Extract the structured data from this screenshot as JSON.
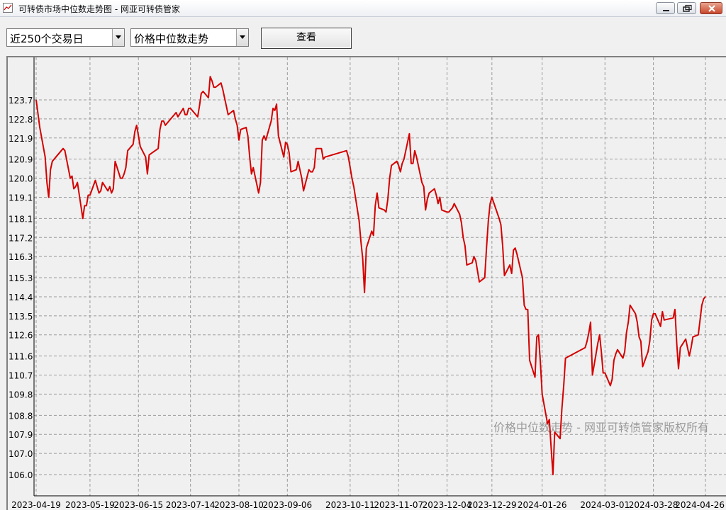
{
  "window": {
    "title": "可转债市场中位数走势图 - 网亚可转债管家"
  },
  "toolbar": {
    "period_select": "近250个交易日",
    "metric_select": "价格中位数走势",
    "view_button": "查看"
  },
  "chart_data": {
    "type": "line",
    "title": "",
    "xlabel": "",
    "ylabel": "",
    "watermark": "价格中位数走势 - 网亚可转债管家版权所有",
    "grid": true,
    "y_ticks": [
      "123.7",
      "122.8",
      "121.9",
      "120.9",
      "120.0",
      "119.1",
      "118.1",
      "117.2",
      "116.3",
      "115.3",
      "114.4",
      "113.5",
      "112.6",
      "111.6",
      "110.7",
      "109.8",
      "108.8",
      "107.9",
      "107.0",
      "106.0"
    ],
    "x_ticks": [
      "2023-04-19",
      "2023-05-19",
      "2023-06-15",
      "2023-07-14",
      "2023-08-10",
      "2023-09-06",
      "2023-10-11",
      "2023-11-07",
      "2023-12-04",
      "2023-12-29",
      "2024-01-26",
      "2024-03-01",
      "2024-03-28",
      "2024-04-26"
    ],
    "ylim": [
      105.3,
      125.5
    ],
    "line_color": "#d40000",
    "series": [
      {
        "name": "",
        "points": [
          [
            "2023-04-19",
            123.7
          ],
          [
            "2023-04-21",
            122.4
          ],
          [
            "2023-04-24",
            121.0
          ],
          [
            "2023-04-25",
            119.8
          ],
          [
            "2023-04-26",
            119.1
          ],
          [
            "2023-04-27",
            120.4
          ],
          [
            "2023-04-28",
            120.8
          ],
          [
            "2023-05-04",
            121.4
          ],
          [
            "2023-05-05",
            121.3
          ],
          [
            "2023-05-08",
            120.0
          ],
          [
            "2023-05-09",
            120.1
          ],
          [
            "2023-05-10",
            119.5
          ],
          [
            "2023-05-11",
            119.6
          ],
          [
            "2023-05-12",
            119.8
          ],
          [
            "2023-05-15",
            118.1
          ],
          [
            "2023-05-16",
            118.7
          ],
          [
            "2023-05-17",
            118.7
          ],
          [
            "2023-05-18",
            119.2
          ],
          [
            "2023-05-19",
            119.2
          ],
          [
            "2023-05-22",
            119.9
          ],
          [
            "2023-05-23",
            119.6
          ],
          [
            "2023-05-24",
            119.3
          ],
          [
            "2023-05-25",
            119.4
          ],
          [
            "2023-05-26",
            119.8
          ],
          [
            "2023-05-29",
            119.4
          ],
          [
            "2023-05-30",
            119.6
          ],
          [
            "2023-05-31",
            119.3
          ],
          [
            "2023-06-01",
            119.5
          ],
          [
            "2023-06-02",
            120.8
          ],
          [
            "2023-06-05",
            120.0
          ],
          [
            "2023-06-06",
            120.0
          ],
          [
            "2023-06-07",
            120.2
          ],
          [
            "2023-06-08",
            120.5
          ],
          [
            "2023-06-09",
            121.3
          ],
          [
            "2023-06-12",
            121.6
          ],
          [
            "2023-06-13",
            122.2
          ],
          [
            "2023-06-14",
            122.5
          ],
          [
            "2023-06-15",
            122.0
          ],
          [
            "2023-06-16",
            121.5
          ],
          [
            "2023-06-19",
            121.0
          ],
          [
            "2023-06-20",
            120.2
          ],
          [
            "2023-06-21",
            121.1
          ],
          [
            "2023-06-26",
            121.4
          ],
          [
            "2023-06-27",
            122.3
          ],
          [
            "2023-06-28",
            122.7
          ],
          [
            "2023-06-29",
            122.7
          ],
          [
            "2023-06-30",
            122.5
          ],
          [
            "2023-07-03",
            122.8
          ],
          [
            "2023-07-04",
            122.9
          ],
          [
            "2023-07-05",
            123.0
          ],
          [
            "2023-07-06",
            123.1
          ],
          [
            "2023-07-07",
            122.9
          ],
          [
            "2023-07-10",
            123.3
          ],
          [
            "2023-07-11",
            123.0
          ],
          [
            "2023-07-12",
            123.0
          ],
          [
            "2023-07-13",
            123.3
          ],
          [
            "2023-07-14",
            123.3
          ],
          [
            "2023-07-17",
            123.0
          ],
          [
            "2023-07-18",
            122.9
          ],
          [
            "2023-07-19",
            123.4
          ],
          [
            "2023-07-20",
            124.0
          ],
          [
            "2023-07-21",
            124.1
          ],
          [
            "2023-07-24",
            123.8
          ],
          [
            "2023-07-25",
            124.8
          ],
          [
            "2023-07-26",
            124.6
          ],
          [
            "2023-07-27",
            124.3
          ],
          [
            "2023-07-28",
            124.3
          ],
          [
            "2023-07-31",
            124.5
          ],
          [
            "2023-08-01",
            124.2
          ],
          [
            "2023-08-02",
            123.8
          ],
          [
            "2023-08-03",
            123.4
          ],
          [
            "2023-08-04",
            123.0
          ],
          [
            "2023-08-07",
            123.2
          ],
          [
            "2023-08-08",
            122.8
          ],
          [
            "2023-08-09",
            122.5
          ],
          [
            "2023-08-10",
            121.8
          ],
          [
            "2023-08-11",
            122.3
          ],
          [
            "2023-08-14",
            122.4
          ],
          [
            "2023-08-15",
            122.0
          ],
          [
            "2023-08-16",
            121.0
          ],
          [
            "2023-08-17",
            120.2
          ],
          [
            "2023-08-18",
            120.5
          ],
          [
            "2023-08-21",
            119.3
          ],
          [
            "2023-08-22",
            119.8
          ],
          [
            "2023-08-23",
            121.8
          ],
          [
            "2023-08-24",
            122.0
          ],
          [
            "2023-08-25",
            121.8
          ],
          [
            "2023-08-28",
            122.7
          ],
          [
            "2023-08-29",
            123.3
          ],
          [
            "2023-08-30",
            123.2
          ],
          [
            "2023-08-31",
            123.5
          ],
          [
            "2023-09-01",
            122.0
          ],
          [
            "2023-09-04",
            121.0
          ],
          [
            "2023-09-05",
            121.7
          ],
          [
            "2023-09-06",
            121.6
          ],
          [
            "2023-09-07",
            121.2
          ],
          [
            "2023-09-08",
            120.3
          ],
          [
            "2023-09-11",
            120.4
          ],
          [
            "2023-09-12",
            120.8
          ],
          [
            "2023-09-13",
            120.4
          ],
          [
            "2023-09-14",
            120.0
          ],
          [
            "2023-09-15",
            119.4
          ],
          [
            "2023-09-18",
            120.4
          ],
          [
            "2023-09-19",
            120.3
          ],
          [
            "2023-09-20",
            120.3
          ],
          [
            "2023-09-21",
            120.5
          ],
          [
            "2023-09-22",
            121.4
          ],
          [
            "2023-09-25",
            121.4
          ],
          [
            "2023-09-26",
            120.9
          ],
          [
            "2023-09-27",
            121.0
          ],
          [
            "2023-10-09",
            121.3
          ],
          [
            "2023-10-10",
            121.0
          ],
          [
            "2023-10-11",
            120.5
          ],
          [
            "2023-10-12",
            120.0
          ],
          [
            "2023-10-13",
            119.6
          ],
          [
            "2023-10-16",
            118.0
          ],
          [
            "2023-10-17",
            117.0
          ],
          [
            "2023-10-18",
            116.2
          ],
          [
            "2023-10-19",
            114.6
          ],
          [
            "2023-10-20",
            116.7
          ],
          [
            "2023-10-23",
            117.5
          ],
          [
            "2023-10-24",
            117.3
          ],
          [
            "2023-10-25",
            118.7
          ],
          [
            "2023-10-26",
            119.3
          ],
          [
            "2023-10-27",
            118.6
          ],
          [
            "2023-10-30",
            118.5
          ],
          [
            "2023-10-31",
            118.4
          ],
          [
            "2023-11-01",
            119.0
          ],
          [
            "2023-11-02",
            120.0
          ],
          [
            "2023-11-03",
            120.6
          ],
          [
            "2023-11-06",
            120.8
          ],
          [
            "2023-11-07",
            120.6
          ],
          [
            "2023-11-08",
            120.3
          ],
          [
            "2023-11-09",
            120.7
          ],
          [
            "2023-11-10",
            120.9
          ],
          [
            "2023-11-13",
            122.1
          ],
          [
            "2023-11-14",
            120.7
          ],
          [
            "2023-11-15",
            120.7
          ],
          [
            "2023-11-16",
            121.3
          ],
          [
            "2023-11-17",
            121.0
          ],
          [
            "2023-11-20",
            119.8
          ],
          [
            "2023-11-21",
            119.6
          ],
          [
            "2023-11-22",
            118.5
          ],
          [
            "2023-11-23",
            119.0
          ],
          [
            "2023-11-24",
            119.3
          ],
          [
            "2023-11-27",
            119.5
          ],
          [
            "2023-11-28",
            119.2
          ],
          [
            "2023-11-29",
            118.8
          ],
          [
            "2023-11-30",
            119.1
          ],
          [
            "2023-12-01",
            118.5
          ],
          [
            "2023-12-04",
            118.4
          ],
          [
            "2023-12-05",
            118.4
          ],
          [
            "2023-12-06",
            118.5
          ],
          [
            "2023-12-07",
            118.6
          ],
          [
            "2023-12-08",
            118.8
          ],
          [
            "2023-12-11",
            118.3
          ],
          [
            "2023-12-12",
            117.9
          ],
          [
            "2023-12-13",
            117.2
          ],
          [
            "2023-12-14",
            116.8
          ],
          [
            "2023-12-15",
            115.9
          ],
          [
            "2023-12-18",
            116.0
          ],
          [
            "2023-12-19",
            116.3
          ],
          [
            "2023-12-20",
            116.1
          ],
          [
            "2023-12-21",
            115.6
          ],
          [
            "2023-12-22",
            115.1
          ],
          [
            "2023-12-25",
            115.3
          ],
          [
            "2023-12-26",
            116.7
          ],
          [
            "2023-12-27",
            118.0
          ],
          [
            "2023-12-28",
            118.8
          ],
          [
            "2023-12-29",
            119.1
          ],
          [
            "2024-01-02",
            118.1
          ],
          [
            "2024-01-03",
            117.8
          ],
          [
            "2024-01-04",
            116.8
          ],
          [
            "2024-01-05",
            115.4
          ],
          [
            "2024-01-08",
            115.9
          ],
          [
            "2024-01-09",
            115.5
          ],
          [
            "2024-01-10",
            116.6
          ],
          [
            "2024-01-11",
            116.7
          ],
          [
            "2024-01-12",
            116.4
          ],
          [
            "2024-01-15",
            115.3
          ],
          [
            "2024-01-16",
            114.0
          ],
          [
            "2024-01-17",
            113.8
          ],
          [
            "2024-01-18",
            113.8
          ],
          [
            "2024-01-19",
            111.4
          ],
          [
            "2024-01-22",
            110.6
          ],
          [
            "2024-01-23",
            112.5
          ],
          [
            "2024-01-24",
            112.6
          ],
          [
            "2024-01-25",
            111.3
          ],
          [
            "2024-01-26",
            109.8
          ],
          [
            "2024-01-29",
            108.4
          ],
          [
            "2024-01-30",
            108.6
          ],
          [
            "2024-01-31",
            107.3
          ],
          [
            "2024-02-01",
            106.0
          ],
          [
            "2024-02-02",
            108.0
          ],
          [
            "2024-02-05",
            107.7
          ],
          [
            "2024-02-06",
            109.1
          ],
          [
            "2024-02-07",
            110.2
          ],
          [
            "2024-02-08",
            111.5
          ],
          [
            "2024-02-19",
            112.0
          ],
          [
            "2024-02-20",
            112.3
          ],
          [
            "2024-02-21",
            112.7
          ],
          [
            "2024-02-22",
            113.2
          ],
          [
            "2024-02-23",
            110.7
          ],
          [
            "2024-02-26",
            112.2
          ],
          [
            "2024-02-27",
            112.6
          ],
          [
            "2024-02-28",
            111.8
          ],
          [
            "2024-02-29",
            110.8
          ],
          [
            "2024-03-01",
            110.8
          ],
          [
            "2024-03-04",
            110.2
          ],
          [
            "2024-03-05",
            110.5
          ],
          [
            "2024-03-06",
            111.4
          ],
          [
            "2024-03-07",
            111.7
          ],
          [
            "2024-03-08",
            111.9
          ],
          [
            "2024-03-11",
            111.5
          ],
          [
            "2024-03-12",
            111.8
          ],
          [
            "2024-03-13",
            112.7
          ],
          [
            "2024-03-14",
            113.2
          ],
          [
            "2024-03-15",
            114.0
          ],
          [
            "2024-03-18",
            113.6
          ],
          [
            "2024-03-19",
            113.2
          ],
          [
            "2024-03-20",
            112.5
          ],
          [
            "2024-03-21",
            112.3
          ],
          [
            "2024-03-22",
            111.1
          ],
          [
            "2024-03-25",
            111.8
          ],
          [
            "2024-03-26",
            112.3
          ],
          [
            "2024-03-27",
            113.3
          ],
          [
            "2024-03-28",
            113.6
          ],
          [
            "2024-03-29",
            113.6
          ],
          [
            "2024-04-01",
            113.0
          ],
          [
            "2024-04-02",
            113.7
          ],
          [
            "2024-04-03",
            113.3
          ],
          [
            "2024-04-08",
            113.4
          ],
          [
            "2024-04-09",
            113.8
          ],
          [
            "2024-04-10",
            112.2
          ],
          [
            "2024-04-11",
            111.0
          ],
          [
            "2024-04-12",
            112.0
          ],
          [
            "2024-04-15",
            112.4
          ],
          [
            "2024-04-16",
            112.0
          ],
          [
            "2024-04-17",
            111.6
          ],
          [
            "2024-04-18",
            112.0
          ],
          [
            "2024-04-19",
            112.5
          ],
          [
            "2024-04-22",
            112.6
          ],
          [
            "2024-04-23",
            113.3
          ],
          [
            "2024-04-24",
            114.0
          ],
          [
            "2024-04-25",
            114.3
          ],
          [
            "2024-04-26",
            114.4
          ]
        ]
      }
    ]
  }
}
